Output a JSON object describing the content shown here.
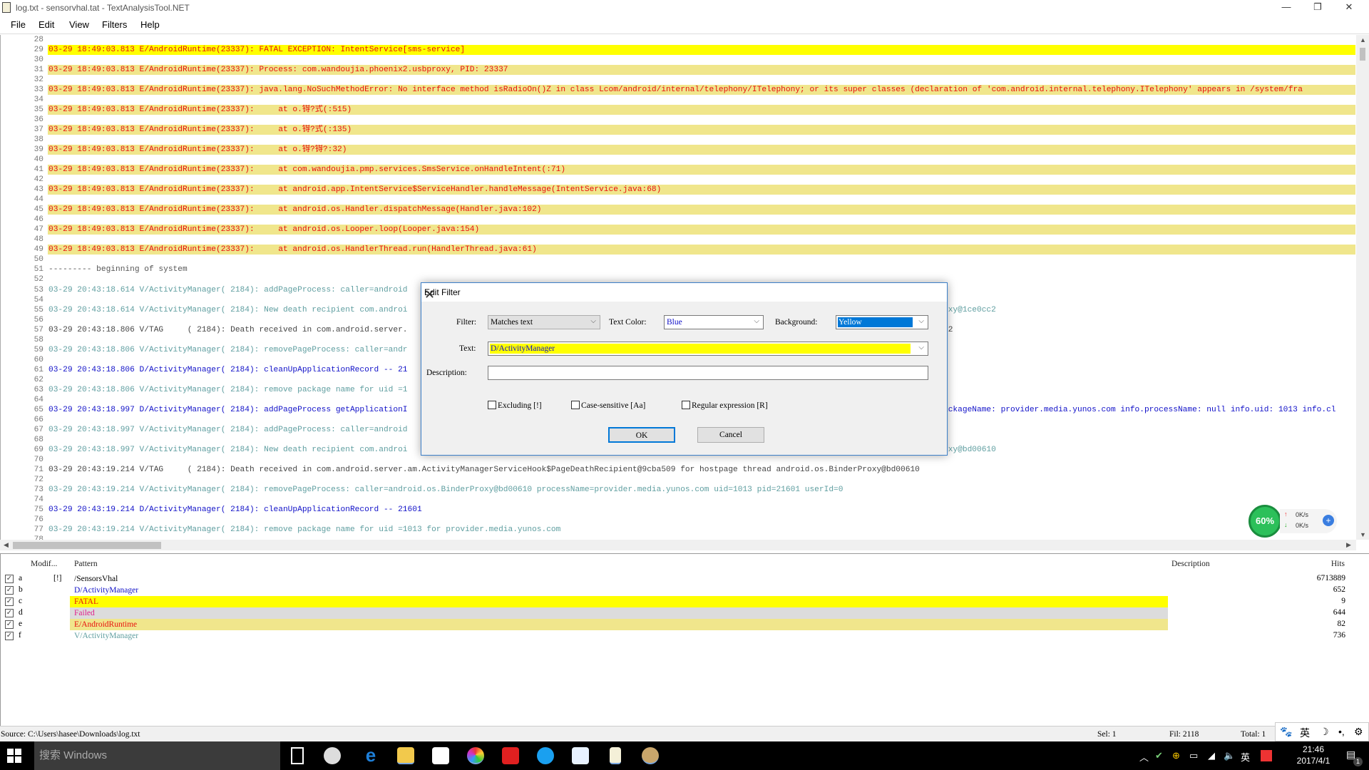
{
  "window": {
    "title": "log.txt - sensorvhal.tat - TextAnalysisTool.NET"
  },
  "menu": [
    "File",
    "Edit",
    "View",
    "Filters",
    "Help"
  ],
  "log_lines": [
    {
      "n": "28",
      "style": "P",
      "text": ""
    },
    {
      "n": "29",
      "style": "F",
      "text": "03-29 18:49:03.813 E/AndroidRuntime(23337): FATAL EXCEPTION: IntentService[sms-service]"
    },
    {
      "n": "30",
      "style": "P",
      "text": ""
    },
    {
      "n": "31",
      "style": "E",
      "text": "03-29 18:49:03.813 E/AndroidRuntime(23337): Process: com.wandoujia.phoenix2.usbproxy, PID: 23337"
    },
    {
      "n": "32",
      "style": "P",
      "text": ""
    },
    {
      "n": "33",
      "style": "E",
      "text": "03-29 18:49:03.813 E/AndroidRuntime(23337): java.lang.NoSuchMethodError: No interface method isRadioOn()Z in class Lcom/android/internal/telephony/ITelephony; or its super classes (declaration of 'com.android.internal.telephony.ITelephony' appears in /system/fra"
    },
    {
      "n": "34",
      "style": "P",
      "text": ""
    },
    {
      "n": "35",
      "style": "E",
      "text": "03-29 18:49:03.813 E/AndroidRuntime(23337):     at o.锝?式(:515)"
    },
    {
      "n": "36",
      "style": "P",
      "text": ""
    },
    {
      "n": "37",
      "style": "E",
      "text": "03-29 18:49:03.813 E/AndroidRuntime(23337):     at o.锝?式(:135)"
    },
    {
      "n": "38",
      "style": "P",
      "text": ""
    },
    {
      "n": "39",
      "style": "E",
      "text": "03-29 18:49:03.813 E/AndroidRuntime(23337):     at o.锝?锝?:32)"
    },
    {
      "n": "40",
      "style": "P",
      "text": ""
    },
    {
      "n": "41",
      "style": "E",
      "text": "03-29 18:49:03.813 E/AndroidRuntime(23337):     at com.wandoujia.pmp.services.SmsService.onHandleIntent(:71)"
    },
    {
      "n": "42",
      "style": "P",
      "text": ""
    },
    {
      "n": "43",
      "style": "E",
      "text": "03-29 18:49:03.813 E/AndroidRuntime(23337):     at android.app.IntentService$ServiceHandler.handleMessage(IntentService.java:68)"
    },
    {
      "n": "44",
      "style": "P",
      "text": ""
    },
    {
      "n": "45",
      "style": "E",
      "text": "03-29 18:49:03.813 E/AndroidRuntime(23337):     at android.os.Handler.dispatchMessage(Handler.java:102)"
    },
    {
      "n": "46",
      "style": "P",
      "text": ""
    },
    {
      "n": "47",
      "style": "E",
      "text": "03-29 18:49:03.813 E/AndroidRuntime(23337):     at android.os.Looper.loop(Looper.java:154)"
    },
    {
      "n": "48",
      "style": "P",
      "text": ""
    },
    {
      "n": "49",
      "style": "E",
      "text": "03-29 18:49:03.813 E/AndroidRuntime(23337):     at android.os.HandlerThread.run(HandlerThread.java:61)"
    },
    {
      "n": "50",
      "style": "P",
      "text": ""
    },
    {
      "n": "51",
      "style": "P",
      "text": "--------- beginning of system"
    },
    {
      "n": "52",
      "style": "P",
      "text": ""
    },
    {
      "n": "53",
      "style": "V",
      "text": "03-29 20:43:18.614 V/ActivityManager( 2184): addPageProcess: caller=android"
    },
    {
      "n": "54",
      "style": "P",
      "text": ""
    },
    {
      "n": "55",
      "style": "V",
      "text": "03-29 20:43:18.614 V/ActivityManager( 2184): New death recipient com.androi",
      "tail": "oxy@1ce0cc2"
    },
    {
      "n": "56",
      "style": "P",
      "text": ""
    },
    {
      "n": "57",
      "style": "T",
      "text": "03-29 20:43:18.806 V/TAG     ( 2184): Death received in com.android.server.",
      "tail": "c2"
    },
    {
      "n": "58",
      "style": "P",
      "text": ""
    },
    {
      "n": "59",
      "style": "V",
      "text": "03-29 20:43:18.806 V/ActivityManager( 2184): removePageProcess: caller=andr"
    },
    {
      "n": "60",
      "style": "P",
      "text": ""
    },
    {
      "n": "61",
      "style": "D",
      "text": "03-29 20:43:18.806 D/ActivityManager( 2184): cleanUpApplicationRecord -- 21"
    },
    {
      "n": "62",
      "style": "P",
      "text": ""
    },
    {
      "n": "63",
      "style": "V",
      "text": "03-29 20:43:18.806 V/ActivityManager( 2184): remove package name for uid =1"
    },
    {
      "n": "64",
      "style": "P",
      "text": ""
    },
    {
      "n": "65",
      "style": "D",
      "text": "03-29 20:43:18.997 D/ActivityManager( 2184): addPageProcess getApplicationI",
      "tail": "ackageName: provider.media.yunos.com info.processName: null info.uid: 1013 info.cl"
    },
    {
      "n": "66",
      "style": "P",
      "text": ""
    },
    {
      "n": "67",
      "style": "V",
      "text": "03-29 20:43:18.997 V/ActivityManager( 2184): addPageProcess: caller=android"
    },
    {
      "n": "68",
      "style": "P",
      "text": ""
    },
    {
      "n": "69",
      "style": "V",
      "text": "03-29 20:43:18.997 V/ActivityManager( 2184): New death recipient com.androi",
      "tail": "oxy@bd00610"
    },
    {
      "n": "70",
      "style": "P",
      "text": ""
    },
    {
      "n": "71",
      "style": "T",
      "text": "03-29 20:43:19.214 V/TAG     ( 2184): Death received in com.android.server.am.ActivityManagerServiceHook$PageDeathRecipient@9cba509 for hostpage thread android.os.BinderProxy@bd00610"
    },
    {
      "n": "72",
      "style": "P",
      "text": ""
    },
    {
      "n": "73",
      "style": "V",
      "text": "03-29 20:43:19.214 V/ActivityManager( 2184): removePageProcess: caller=android.os.BinderProxy@bd00610 processName=provider.media.yunos.com uid=1013 pid=21601 userId=0"
    },
    {
      "n": "74",
      "style": "P",
      "text": ""
    },
    {
      "n": "75",
      "style": "D",
      "text": "03-29 20:43:19.214 D/ActivityManager( 2184): cleanUpApplicationRecord -- 21601"
    },
    {
      "n": "76",
      "style": "P",
      "text": ""
    },
    {
      "n": "77",
      "style": "V",
      "text": "03-29 20:43:19.214 V/ActivityManager( 2184): remove package name for uid =1013 for provider.media.yunos.com"
    },
    {
      "n": "78",
      "style": "P",
      "text": ""
    }
  ],
  "filters": {
    "columns": {
      "modified": "Modif...",
      "pattern": "Pattern",
      "description": "Description",
      "hits": "Hits"
    },
    "rows": [
      {
        "checked": true,
        "letter": "a",
        "modifier": "[!]",
        "pattern": "/SensorsVhal",
        "color": "#000000",
        "bg": "",
        "hits": "6713889"
      },
      {
        "checked": true,
        "letter": "b",
        "modifier": "",
        "pattern": "D/ActivityManager",
        "color": "#1010c8",
        "bg": "",
        "hits": "652"
      },
      {
        "checked": true,
        "letter": "c",
        "modifier": "",
        "pattern": "FATAL",
        "color": "#e8100e",
        "bg": "#ffff00",
        "hits": "9"
      },
      {
        "checked": true,
        "letter": "d",
        "modifier": "",
        "pattern": "Failed",
        "color": "#e0208c",
        "bg": "#dcdcdc",
        "hits": "644"
      },
      {
        "checked": true,
        "letter": "e",
        "modifier": "",
        "pattern": "E/AndroidRuntime",
        "color": "#e8100e",
        "bg": "#f0e68c",
        "hits": "82"
      },
      {
        "checked": true,
        "letter": "f",
        "modifier": "",
        "pattern": "V/ActivityManager",
        "color": "#5f9ea0",
        "bg": "",
        "hits": "736"
      }
    ]
  },
  "status": {
    "source": "Source: C:\\Users\\hasee\\Downloads\\log.txt",
    "sel": "Sel: 1",
    "fil": "Fil: 2118",
    "total": "Total: 1"
  },
  "ime": {
    "lang": "英"
  },
  "dialog": {
    "title": "Edit Filter",
    "filter_label": "Filter:",
    "filter_value": "Matches text",
    "text_color_label": "Text Color:",
    "text_color_value": "Blue",
    "background_label": "Background:",
    "background_value": "Yellow",
    "text_label": "Text:",
    "text_value": "D/ActivityManager",
    "description_label": "Description:",
    "description_value": "",
    "excluding": "Excluding [!]",
    "case_sensitive": "Case-sensitive [Aa]",
    "regex": "Regular expression [R]",
    "ok": "OK",
    "cancel": "Cancel"
  },
  "net_widget": {
    "percent": "60%",
    "up": "0K/s",
    "down": "0K/s"
  },
  "taskbar": {
    "search_placeholder": "搜索 Windows",
    "time": "21:46",
    "date": "2017/4/1",
    "tray_lang": "英",
    "notifications": "1"
  }
}
